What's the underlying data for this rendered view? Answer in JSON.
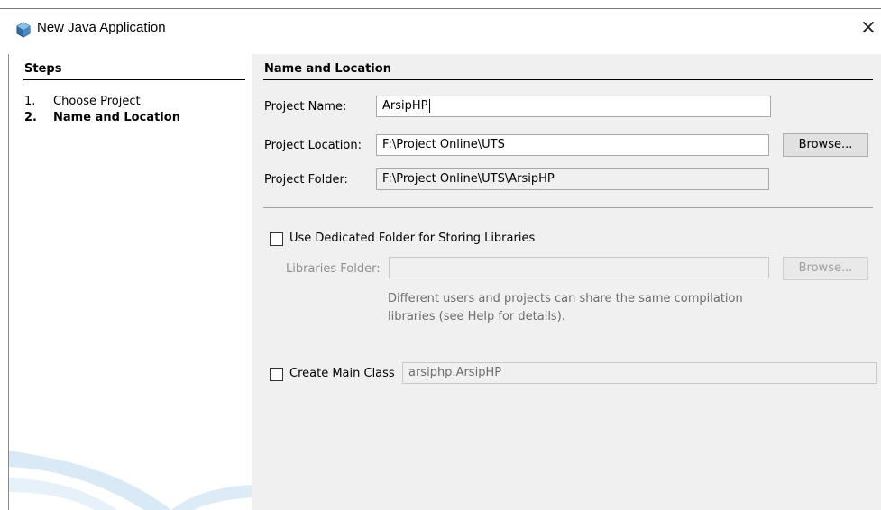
{
  "window": {
    "title": "New Java Application",
    "close_glyph": "×",
    "icon": "java-cube-icon"
  },
  "steps": {
    "title": "Steps",
    "items": [
      {
        "num": "1.",
        "label": "Choose Project"
      },
      {
        "num": "2.",
        "label": "Name and Location"
      }
    ]
  },
  "panel": {
    "title": "Name and Location",
    "project_name": {
      "label": "Project Name:",
      "value": "ArsipHP"
    },
    "project_location": {
      "label": "Project Location:",
      "value": "F:\\Project Online\\UTS",
      "browse_label": "Browse..."
    },
    "project_folder": {
      "label": "Project Folder:",
      "value": "F:\\Project Online\\UTS\\ArsipHP"
    },
    "dedicated_folder": {
      "label": "Use Dedicated Folder for Storing Libraries",
      "checked": false
    },
    "libraries_folder": {
      "label": "Libraries Folder:",
      "value": "",
      "browse_label": "Browse..."
    },
    "help_line1": "Different users and projects can share the same compilation",
    "help_line2": "libraries (see Help for details).",
    "main_class": {
      "label": "Create Main Class",
      "value": "arsiphp.ArsipHP",
      "checked": false
    }
  },
  "colors": {
    "right_panel_bg": "#f0f0f0",
    "left_panel_bg": "#ffffff",
    "swoosh": "#cfe3f2"
  }
}
